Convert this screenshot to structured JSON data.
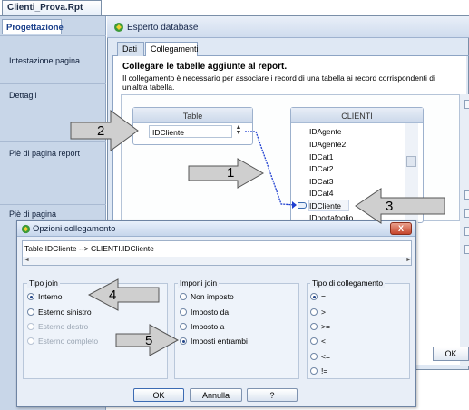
{
  "document_tab": "Clienti_Prova.Rpt",
  "left_panel": {
    "tab": "Progettazione",
    "sections": [
      "Intestazione pagina",
      "Dettagli",
      "Piè di pagina report",
      "Piè di pagina"
    ]
  },
  "wizard": {
    "title": "Esperto database",
    "tabs": [
      "Dati",
      "Collegamenti"
    ],
    "heading": "Collegare le tabelle aggiunte al report.",
    "description_line1": "Il collegamento è necessario per associare i record di una tabella ai record corrispondenti di",
    "description_line2": "un'altra tabella.",
    "table_box": {
      "title": "Table",
      "field": "IDCliente"
    },
    "clienti_box": {
      "title": "CLIENTI",
      "fields": [
        "IDAgente",
        "IDAgente2",
        "IDCat1",
        "IDCat2",
        "IDCat3",
        "IDCat4",
        "IDCliente",
        "IDportafoglio"
      ],
      "selected": "IDCliente"
    },
    "ok_label": "OK"
  },
  "dialog": {
    "title": "Opzioni collegamento",
    "close_label": "X",
    "expression": "Table.IDCliente --> CLIENTI.IDCliente",
    "scroll_left": "◄",
    "scroll_right": "►",
    "tipo_join": {
      "title": "Tipo join",
      "options": [
        {
          "label": "Interno",
          "checked": true,
          "disabled": false
        },
        {
          "label": "Esterno sinistro",
          "checked": false,
          "disabled": false
        },
        {
          "label": "Esterno destro",
          "checked": false,
          "disabled": true
        },
        {
          "label": "Esterno completo",
          "checked": false,
          "disabled": true
        }
      ]
    },
    "imponi_join": {
      "title": "Imponi join",
      "options": [
        {
          "label": "Non imposto",
          "checked": false
        },
        {
          "label": "Imposto da",
          "checked": false
        },
        {
          "label": "Imposto a",
          "checked": false
        },
        {
          "label": "Imposti entrambi",
          "checked": true
        }
      ]
    },
    "tipo_collegamento": {
      "title": "Tipo di collegamento",
      "options": [
        {
          "label": "=",
          "checked": true
        },
        {
          "label": ">",
          "checked": false
        },
        {
          "label": ">=",
          "checked": false
        },
        {
          "label": "<",
          "checked": false
        },
        {
          "label": "<=",
          "checked": false
        },
        {
          "label": "!=",
          "checked": false
        }
      ]
    },
    "buttons": {
      "ok": "OK",
      "cancel": "Annulla",
      "help": "?"
    }
  },
  "annotations": [
    "1",
    "2",
    "3",
    "4",
    "5"
  ],
  "colors": {
    "link_line": "#1f3fd0",
    "annotation_arrow": "#c8c8c8",
    "close_button": "#c5442b"
  }
}
